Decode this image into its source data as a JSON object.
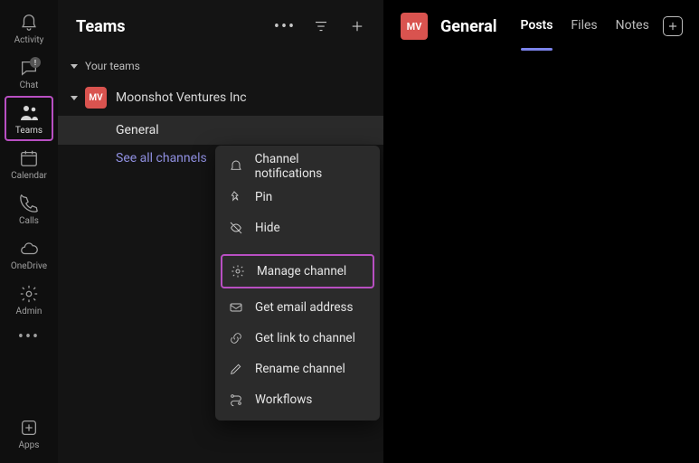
{
  "rail": {
    "activity": "Activity",
    "chat": "Chat",
    "teams": "Teams",
    "calendar": "Calendar",
    "calls": "Calls",
    "onedrive": "OneDrive",
    "admin": "Admin",
    "apps": "Apps"
  },
  "panel": {
    "title": "Teams",
    "section": "Your teams",
    "team": {
      "initials": "MV",
      "name": "Moonshot Ventures Inc"
    },
    "channel": "General",
    "see_all": "See all channels"
  },
  "context_menu": {
    "notifications": "Channel notifications",
    "pin": "Pin",
    "hide": "Hide",
    "manage": "Manage channel",
    "email": "Get email address",
    "link": "Get link to channel",
    "rename": "Rename channel",
    "workflows": "Workflows"
  },
  "main": {
    "avatar_initials": "MV",
    "title": "General",
    "tabs": {
      "posts": "Posts",
      "files": "Files",
      "notes": "Notes"
    }
  }
}
